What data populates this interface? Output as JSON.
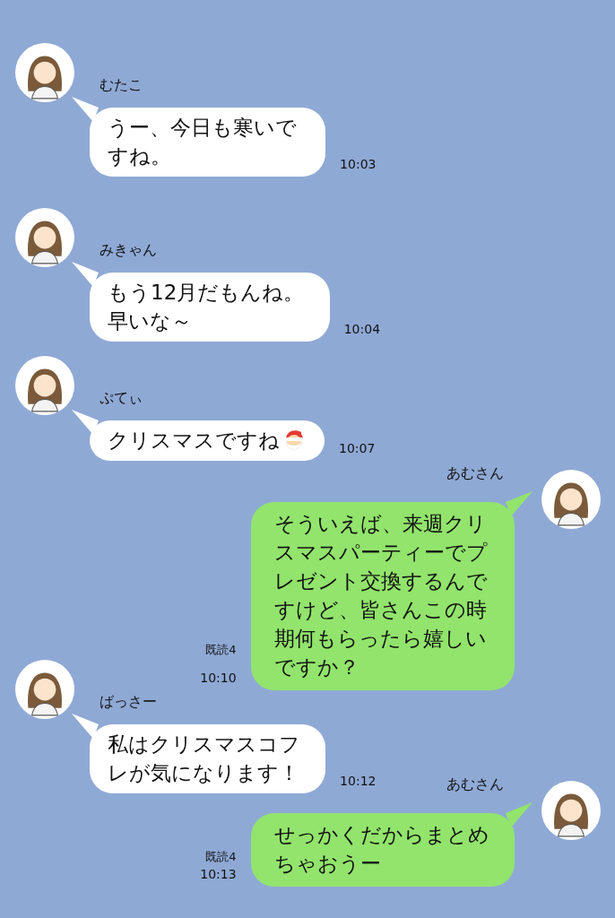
{
  "messages": [
    {
      "kind": "received",
      "sender": "むたこ",
      "text": "うー、今日も寒いですね。",
      "time": "10:03"
    },
    {
      "kind": "received",
      "sender": "みきゃん",
      "text": "もう12月だもんね。早いな～",
      "time": "10:04"
    },
    {
      "kind": "received",
      "sender": "ぷてぃ",
      "text": "クリスマスですね",
      "emoji": true,
      "time": "10:07"
    },
    {
      "kind": "sent",
      "sender": "あむさん",
      "text": "そういえば、来週クリスマスパーティーでプレゼント交換するんですけど、皆さんこの時期何もらったら嬉しいですか？",
      "read": "既読4",
      "time": "10:10"
    },
    {
      "kind": "received",
      "sender": "ばっさー",
      "text": "私はクリスマスコフレが気になります！",
      "time": "10:12"
    },
    {
      "kind": "sent",
      "sender": "あむさん",
      "text": "せっかくだからまとめちゃおうー",
      "read": "既読4",
      "time": "10:13"
    }
  ]
}
